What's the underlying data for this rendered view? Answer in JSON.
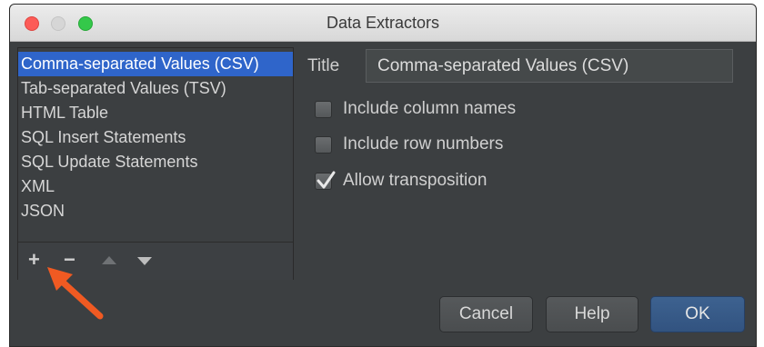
{
  "window": {
    "title": "Data Extractors"
  },
  "extractors": [
    {
      "label": "Comma-separated Values (CSV)",
      "selected": true
    },
    {
      "label": "Tab-separated Values (TSV)",
      "selected": false
    },
    {
      "label": "HTML Table",
      "selected": false
    },
    {
      "label": "SQL Insert Statements",
      "selected": false
    },
    {
      "label": "SQL Update Statements",
      "selected": false
    },
    {
      "label": "XML",
      "selected": false
    },
    {
      "label": "JSON",
      "selected": false
    }
  ],
  "list_toolbar": {
    "add_icon": "plus-icon",
    "remove_icon": "minus-icon",
    "move_up_icon": "triangle-up-icon",
    "move_down_icon": "triangle-down-icon"
  },
  "form": {
    "title_label": "Title",
    "title_value": "Comma-separated Values (CSV)",
    "options": [
      {
        "label": "Include column names",
        "checked": false
      },
      {
        "label": "Include row numbers",
        "checked": false
      },
      {
        "label": "Allow transposition",
        "checked": true
      }
    ]
  },
  "buttons": {
    "cancel": "Cancel",
    "help": "Help",
    "ok": "OK"
  },
  "colors": {
    "selection": "#2f65ca",
    "panel_bg": "#3c3f41",
    "ok_button": "#3d6290",
    "annotation_arrow": "#f05a22"
  }
}
